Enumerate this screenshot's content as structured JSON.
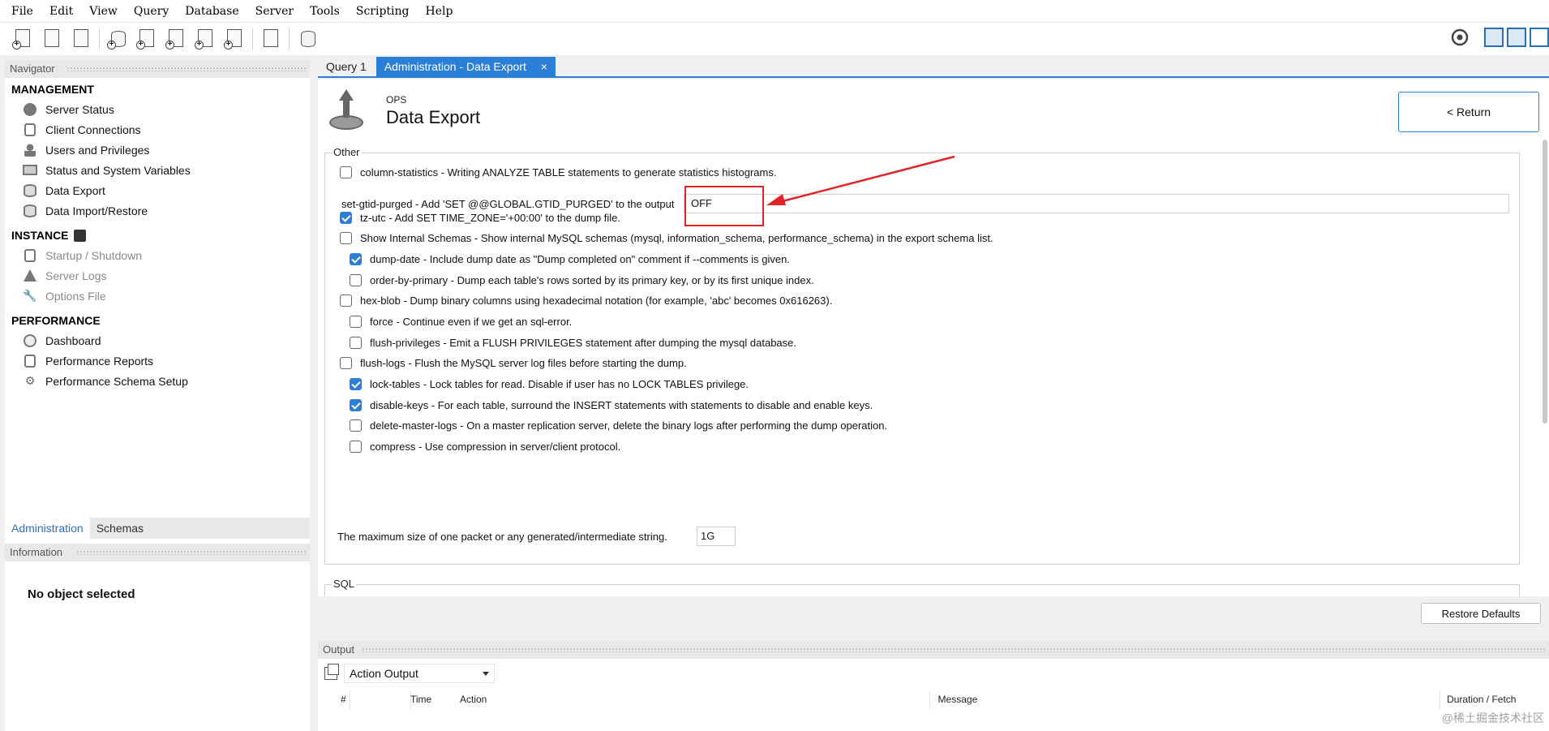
{
  "menubar": {
    "items": [
      "File",
      "Edit",
      "View",
      "Query",
      "Database",
      "Server",
      "Tools",
      "Scripting",
      "Help"
    ]
  },
  "toolbar": {
    "icons": [
      "new-sql-tab-icon",
      "open-sql-script-icon",
      "info-icon",
      "new-schema-icon",
      "new-table-icon",
      "new-view-icon",
      "new-procedure-icon",
      "new-function-icon",
      "search-table-data-icon",
      "reconnect-icon"
    ]
  },
  "navigator": {
    "title": "Navigator",
    "management": {
      "title": "MANAGEMENT",
      "items": [
        "Server Status",
        "Client Connections",
        "Users and Privileges",
        "Status and System Variables",
        "Data Export",
        "Data Import/Restore"
      ]
    },
    "instance": {
      "title": "INSTANCE",
      "items": [
        "Startup / Shutdown",
        "Server Logs",
        "Options File"
      ]
    },
    "performance": {
      "title": "PERFORMANCE",
      "items": [
        "Dashboard",
        "Performance Reports",
        "Performance Schema Setup"
      ]
    },
    "tabs": [
      "Administration",
      "Schemas"
    ]
  },
  "information": {
    "title": "Information",
    "empty": "No object selected"
  },
  "doc_tabs": [
    {
      "label": "Query 1"
    },
    {
      "label": "Administration - Data Export",
      "close": "×"
    }
  ],
  "page": {
    "subtitle": "OPS",
    "title": "Data Export",
    "return_label": "< Return"
  },
  "other": {
    "legend": "Other",
    "options": [
      {
        "label": "column-statistics - Writing ANALYZE TABLE statements to generate statistics histograms.",
        "checked": false
      },
      {
        "label": "tz-utc - Add SET TIME_ZONE='+00:00' to the dump file.",
        "checked": true
      },
      {
        "label": "Show Internal Schemas - Show internal MySQL schemas (mysql, information_schema, performance_schema) in the export schema list.",
        "checked": false
      },
      {
        "label": "dump-date - Include dump date as \"Dump completed on\" comment if --comments is given.",
        "checked": true
      },
      {
        "label": "order-by-primary - Dump each table's rows sorted by its primary key, or by its first unique index.",
        "checked": false
      },
      {
        "label": "hex-blob - Dump binary columns using hexadecimal notation (for example, 'abc' becomes 0x616263).",
        "checked": false
      },
      {
        "label": "force - Continue even if we get an sql-error.",
        "checked": false
      },
      {
        "label": "flush-privileges - Emit a FLUSH PRIVILEGES statement after dumping the mysql database.",
        "checked": false
      },
      {
        "label": "flush-logs - Flush the MySQL server log files before starting the dump.",
        "checked": false
      },
      {
        "label": "lock-tables - Lock tables for read. Disable if user has no LOCK TABLES privilege.",
        "checked": true
      },
      {
        "label": "disable-keys - For each table, surround the INSERT statements with statements to disable and enable keys.",
        "checked": true
      },
      {
        "label": "delete-master-logs - On a master replication server, delete the binary logs after performing the dump operation.",
        "checked": false
      },
      {
        "label": "compress - Use compression in server/client protocol.",
        "checked": false
      }
    ],
    "gtid_label": "set-gtid-purged - Add 'SET @@GLOBAL.GTID_PURGED' to the output",
    "gtid_value": "OFF",
    "packet_label": "The maximum size of one packet or any generated/intermediate string.",
    "packet_value": "1G"
  },
  "sql": {
    "legend": "SQL"
  },
  "restore_defaults": "Restore Defaults",
  "output": {
    "title": "Output",
    "selected": "Action Output",
    "columns": [
      "#",
      "Time",
      "Action",
      "Message",
      "Duration / Fetch"
    ]
  },
  "watermark": "@稀土掘金技术社区",
  "colors": {
    "accent": "#2c7fd6",
    "annotation": "#e0242a"
  }
}
